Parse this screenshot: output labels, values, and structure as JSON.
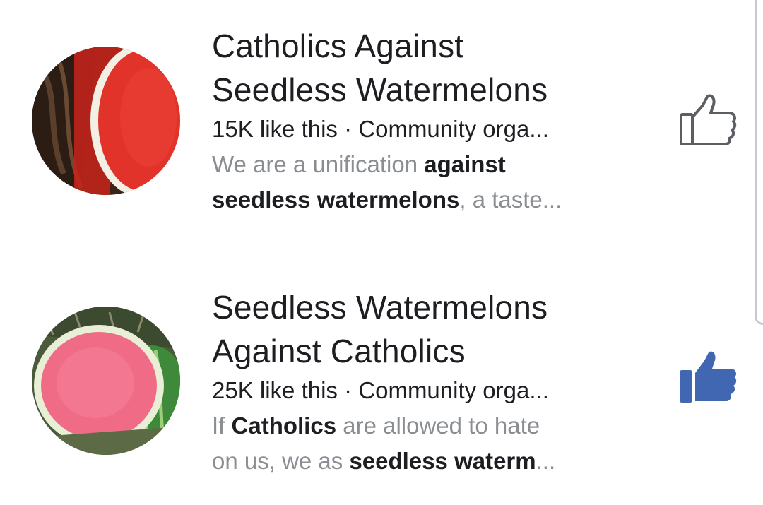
{
  "results": [
    {
      "title_line1": "Catholics Against",
      "title_line2": "Seedless Watermelons",
      "likes": "15K like this",
      "separator": " · ",
      "category": "Community orga...",
      "desc_line1": [
        {
          "text": "We are a unification ",
          "bold": false
        },
        {
          "text": "against",
          "bold": true
        }
      ],
      "desc_line2": [
        {
          "text": "seedless watermelons",
          "bold": true
        },
        {
          "text": ", a taste...",
          "bold": false
        }
      ],
      "liked": false,
      "like_icon": "thumbs-up-outline-icon",
      "avatar_icon": "watermelon-slice-red-image"
    },
    {
      "title_line1": "Seedless Watermelons",
      "title_line2": "Against Catholics",
      "likes": "25K like this",
      "separator": " · ",
      "category": "Community orga...",
      "desc_line1": [
        {
          "text": "If ",
          "bold": false
        },
        {
          "text": "Catholics",
          "bold": true
        },
        {
          "text": " are allowed to hate",
          "bold": false
        }
      ],
      "desc_line2": [
        {
          "text": "on us, we as ",
          "bold": false
        },
        {
          "text": "seedless waterm",
          "bold": true
        },
        {
          "text": "...",
          "bold": false
        }
      ],
      "liked": true,
      "like_icon": "thumbs-up-filled-icon",
      "avatar_icon": "watermelon-slice-pink-image"
    }
  ],
  "colors": {
    "liked_blue": "#4267b2",
    "outline_gray": "#5b5e63",
    "title_text": "#1c1e21",
    "secondary_text": "#8a8d91"
  }
}
